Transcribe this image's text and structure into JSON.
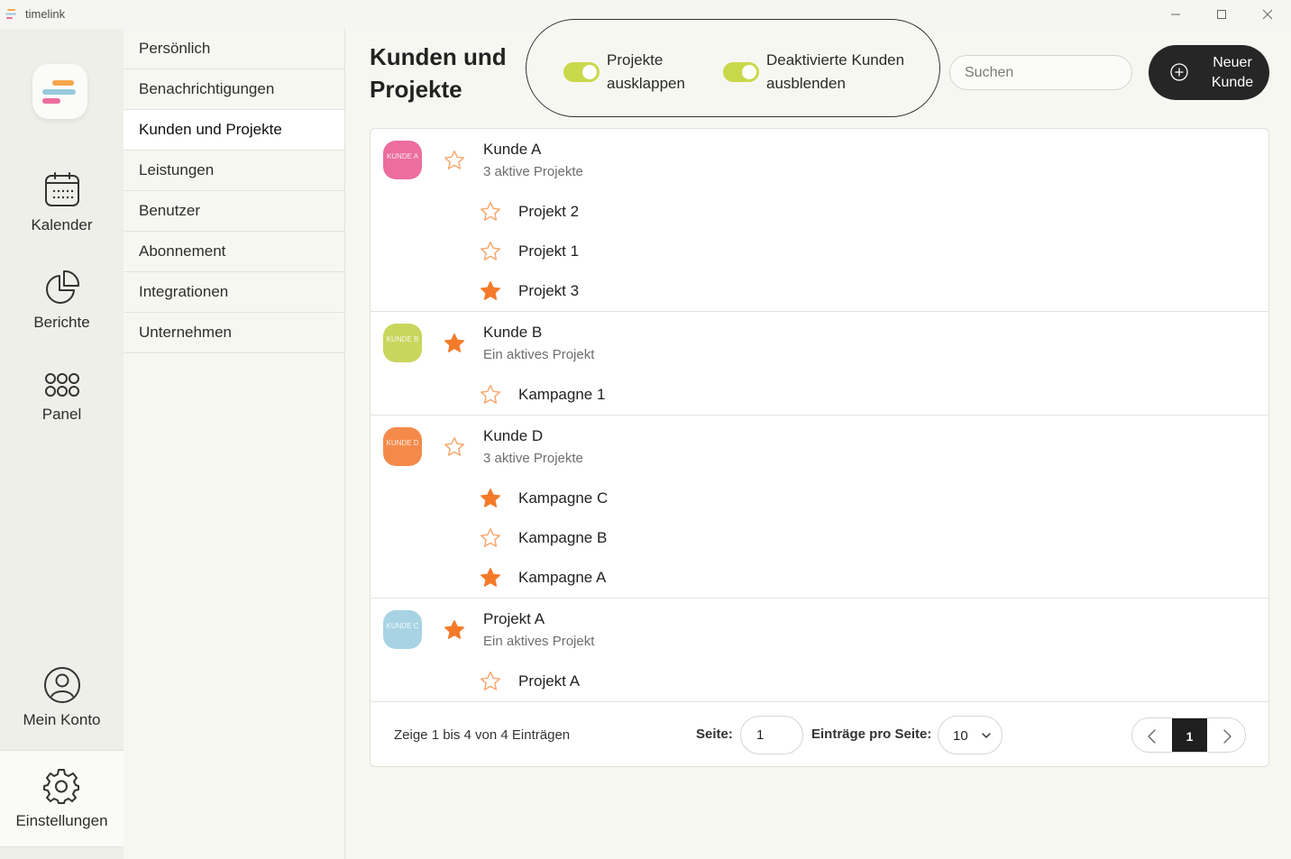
{
  "window": {
    "app_name": "timelink",
    "controls": {
      "minimize": "—",
      "maximize": "☐",
      "close": "✕"
    }
  },
  "rail": {
    "items": [
      {
        "label": "Kalender",
        "icon": "calendar-icon"
      },
      {
        "label": "Berichte",
        "icon": "pie-chart-icon"
      },
      {
        "label": "Panel",
        "icon": "grid-icon"
      },
      {
        "label": "Mein Konto",
        "icon": "account-icon"
      },
      {
        "label": "Einstellungen",
        "icon": "gear-icon",
        "active": true
      }
    ]
  },
  "settings_nav": {
    "items": [
      "Persönlich",
      "Benachrichtigungen",
      "Kunden und Projekte",
      "Leistungen",
      "Benutzer",
      "Abonnement",
      "Integrationen",
      "Unternehmen"
    ],
    "active": "Kunden und Projekte"
  },
  "header": {
    "title": "Kunden und Projekte",
    "toggle_expand_label": "Projekte ausklappen",
    "toggle_expand_on": true,
    "toggle_hide_label": "Deaktivierte Kunden ausblenden",
    "toggle_hide_on": true,
    "search_placeholder": "Suchen",
    "new_button_label": "Neuer Kunde"
  },
  "colors": {
    "accent_green": "#c9d84a",
    "star_orange": "#f47a2a",
    "dark_button": "#262626"
  },
  "customers": [
    {
      "name": "Kunde A",
      "subtitle": "3 aktive Projekte",
      "avatar_text": "KUNDE A",
      "avatar_color": "#ec6d9e",
      "favorite": false,
      "projects": [
        {
          "name": "Projekt 2",
          "favorite": false
        },
        {
          "name": "Projekt 1",
          "favorite": false
        },
        {
          "name": "Projekt 3",
          "favorite": true
        }
      ]
    },
    {
      "name": "Kunde B",
      "subtitle": "Ein aktives Projekt",
      "avatar_text": "KUNDE B",
      "avatar_color": "#c9d65d",
      "favorite": true,
      "projects": [
        {
          "name": "Kampagne 1",
          "favorite": false
        }
      ]
    },
    {
      "name": "Kunde D",
      "subtitle": "3 aktive Projekte",
      "avatar_text": "KUNDE D",
      "avatar_color": "#f48a4a",
      "favorite": false,
      "projects": [
        {
          "name": "Kampagne C",
          "favorite": true
        },
        {
          "name": "Kampagne B",
          "favorite": false
        },
        {
          "name": "Kampagne A",
          "favorite": true
        }
      ]
    },
    {
      "name": "Projekt A",
      "subtitle": "Ein aktives Projekt",
      "avatar_text": "KUNDE C",
      "avatar_color": "#a7d3e4",
      "favorite": true,
      "projects": [
        {
          "name": "Projekt A",
          "favorite": false
        }
      ]
    }
  ],
  "footer": {
    "info": "Zeige 1 bis 4 von 4 Einträgen",
    "page_label": "Seite:",
    "page_value": "1",
    "per_page_label": "Einträge pro Seite:",
    "per_page_value": "10",
    "current_page": "1"
  }
}
